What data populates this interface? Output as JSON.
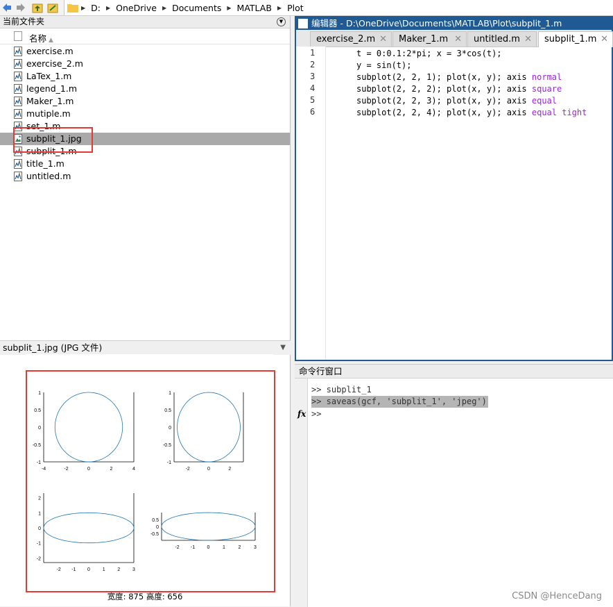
{
  "address_bar": {
    "crumbs": [
      "D:",
      "OneDrive",
      "Documents",
      "MATLAB",
      "Plot"
    ]
  },
  "current_folder": {
    "title": "当前文件夹",
    "name_column": "名称",
    "files": [
      {
        "name": "exercise.m",
        "type": "m"
      },
      {
        "name": "exercise_2.m",
        "type": "m"
      },
      {
        "name": "LaTex_1.m",
        "type": "m"
      },
      {
        "name": "legend_1.m",
        "type": "m"
      },
      {
        "name": "Maker_1.m",
        "type": "m"
      },
      {
        "name": "mutiple.m",
        "type": "m"
      },
      {
        "name": "set_1.m",
        "type": "m"
      },
      {
        "name": "subplit_1.jpg",
        "type": "jpg",
        "selected": true
      },
      {
        "name": "subplit_1.m",
        "type": "m"
      },
      {
        "name": "title_1.m",
        "type": "m"
      },
      {
        "name": "untitled.m",
        "type": "m"
      }
    ]
  },
  "preview": {
    "title": "subplit_1.jpg  (JPG 文件)",
    "caption": "宽度: 875 高度: 656",
    "subplots": [
      {
        "yticks": [
          "1",
          "0.5",
          "0",
          "-0.5",
          "-1"
        ],
        "xticks": [
          "-4",
          "-2",
          "0",
          "2",
          "4"
        ]
      },
      {
        "yticks": [
          "1",
          "0.5",
          "0",
          "-0.5",
          "-1"
        ],
        "xticks": [
          "-2",
          "0",
          "2"
        ]
      },
      {
        "yticks": [
          "2",
          "1",
          "0",
          "-1",
          "-2"
        ],
        "xticks": [
          "-2",
          "-1",
          "0",
          "1",
          "2",
          "3"
        ]
      },
      {
        "yticks": [
          "0.5",
          "0",
          "-0.5"
        ],
        "xticks": [
          "-2",
          "-1",
          "0",
          "1",
          "2",
          "3"
        ]
      }
    ]
  },
  "editor": {
    "title": "编辑器 - D:\\OneDrive\\Documents\\MATLAB\\Plot\\subplit_1.m",
    "tabs": [
      "exercise_2.m",
      "Maker_1.m",
      "untitled.m",
      "subplit_1.m"
    ],
    "active_tab": "subplit_1.m",
    "lines": [
      {
        "num": "1",
        "code": "t = 0:0.1:2*pi; x = 3*cos(t);",
        "kw": ""
      },
      {
        "num": "2",
        "code": "y = sin(t);",
        "kw": ""
      },
      {
        "num": "3",
        "code": "subplot(2, 2, 1); plot(x, y); axis ",
        "kw": "normal"
      },
      {
        "num": "4",
        "code": "subplot(2, 2, 2); plot(x, y); axis ",
        "kw": "square"
      },
      {
        "num": "5",
        "code": "subplot(2, 2, 3); plot(x, y); axis ",
        "kw": "equal"
      },
      {
        "num": "6",
        "code": "subplot(2, 2, 4); plot(x, y); axis ",
        "kw": "equal tight"
      }
    ]
  },
  "command_window": {
    "title": "命令行窗口",
    "lines": [
      ">> subplit_1",
      ">> saveas(gcf, 'subplit_1', 'jpeg')",
      ">>"
    ],
    "fx": "fx"
  },
  "watermark": "CSDN @HenceDang",
  "colors": {
    "editor_title_bg": "#1f5a94",
    "keyword": "#a020f0",
    "highlight_frame": "#e53935",
    "plot_line": "#1f77b4"
  }
}
